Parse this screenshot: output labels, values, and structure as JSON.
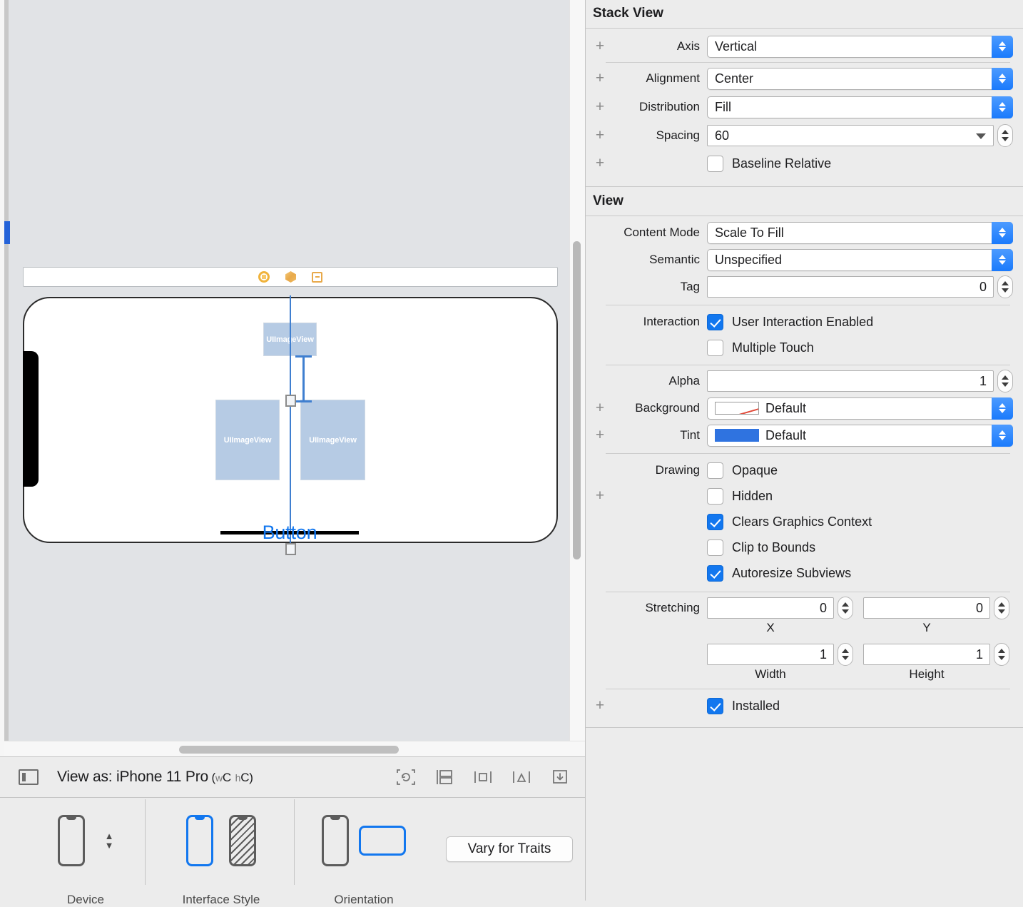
{
  "canvas": {
    "scene_dock_icons": [
      "view-controller-icon",
      "first-responder-icon",
      "exit-icon"
    ],
    "image_views": [
      {
        "label": "UIImageView"
      },
      {
        "label": "UIImageView"
      },
      {
        "label": "UIImageView"
      }
    ],
    "button_label": "Button"
  },
  "bottom_bar": {
    "sidebar_toggle_icon": "sidebar-toggle-icon",
    "view_as_prefix": "View as: ",
    "device_name": "iPhone 11 Pro",
    "trait_open": " (",
    "w_sub": "w",
    "w_class": "C",
    "h_sub": "h",
    "h_class": "C",
    "trait_close": ")",
    "autolayout_tools": [
      "update-frames-icon",
      "embed-in-stack-icon",
      "align-icon",
      "add-new-constraints-icon",
      "resolve-auto-layout-issues-icon"
    ]
  },
  "trait_bar": {
    "device_label": "Device",
    "interface_style_label": "Interface Style",
    "orientation_label": "Orientation",
    "vary_button": "Vary for Traits"
  },
  "inspector": {
    "stack_view": {
      "title": "Stack View",
      "axis_label": "Axis",
      "axis_value": "Vertical",
      "alignment_label": "Alignment",
      "alignment_value": "Center",
      "distribution_label": "Distribution",
      "distribution_value": "Fill",
      "spacing_label": "Spacing",
      "spacing_value": "60",
      "baseline_relative_label": "Baseline Relative",
      "baseline_relative_checked": false
    },
    "view": {
      "title": "View",
      "content_mode_label": "Content Mode",
      "content_mode_value": "Scale To Fill",
      "semantic_label": "Semantic",
      "semantic_value": "Unspecified",
      "tag_label": "Tag",
      "tag_value": "0",
      "interaction_label": "Interaction",
      "user_interaction_enabled_label": "User Interaction Enabled",
      "user_interaction_enabled_checked": true,
      "multiple_touch_label": "Multiple Touch",
      "multiple_touch_checked": false,
      "alpha_label": "Alpha",
      "alpha_value": "1",
      "background_label": "Background",
      "background_value": "Default",
      "background_swatch": "#ffffff",
      "tint_label": "Tint",
      "tint_value": "Default",
      "tint_swatch": "#2f73e0",
      "drawing_label": "Drawing",
      "opaque_label": "Opaque",
      "opaque_checked": false,
      "hidden_label": "Hidden",
      "hidden_checked": false,
      "clears_graphics_context_label": "Clears Graphics Context",
      "clears_graphics_context_checked": true,
      "clip_to_bounds_label": "Clip to Bounds",
      "clip_to_bounds_checked": false,
      "autoresize_subviews_label": "Autoresize Subviews",
      "autoresize_subviews_checked": true,
      "stretching_label": "Stretching",
      "stretching_x_value": "0",
      "stretching_y_value": "0",
      "stretching_x_label": "X",
      "stretching_y_label": "Y",
      "stretching_w_value": "1",
      "stretching_h_value": "1",
      "stretching_w_label": "Width",
      "stretching_h_label": "Height",
      "installed_label": "Installed",
      "installed_checked": true
    }
  },
  "colors": {
    "accent_blue": "#1277ef",
    "panel_bg": "#ececec",
    "canvas_bg": "#e1e3e6",
    "imageview_fill": "#b6cbe4",
    "selection_blue": "#3f7fd0"
  }
}
